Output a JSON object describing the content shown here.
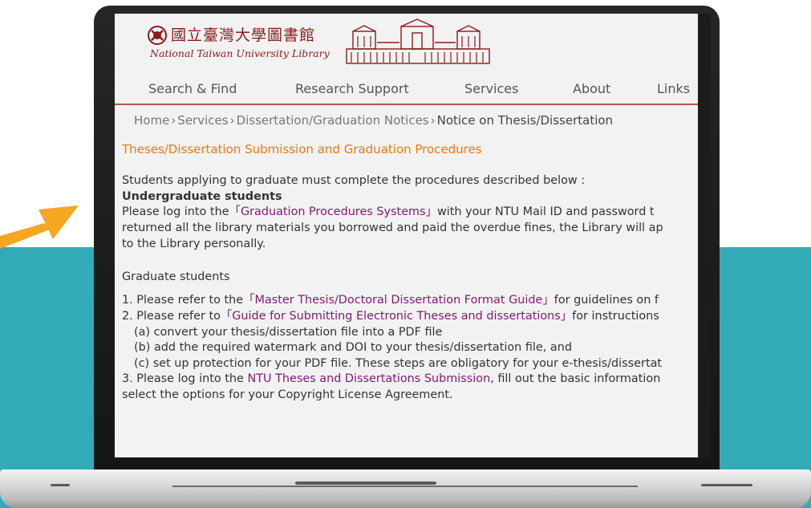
{
  "library": {
    "name_zh": "國立臺灣大學圖書館",
    "name_en": "National Taiwan University Library"
  },
  "nav": {
    "items": [
      "Search & Find",
      "Research Support",
      "Services",
      "About",
      "Links"
    ]
  },
  "breadcrumb": {
    "items": [
      "Home",
      "Services",
      "Dissertation/Graduation Notices"
    ],
    "current": "Notice on Thesis/Dissertation",
    "separator": "›"
  },
  "content": {
    "title": "Theses/Dissertation Submission and Graduation Procedures",
    "intro": "Students applying to graduate must complete the procedures described below :",
    "undergrad": {
      "heading": "Undergraduate students",
      "line1_pre": "Please log into the",
      "line1_link": "「Graduation Procedures Systems」",
      "line1_post": "with your NTU Mail ID and password t",
      "line2": "returned all the library materials you borrowed and paid the overdue fines, the Library will ap",
      "line3": "to the Library personally."
    },
    "grad": {
      "heading": "Graduate students",
      "item1_pre": "1. Please refer to the",
      "item1_link": "「Master Thesis/Doctoral Dissertation Format Guide」",
      "item1_post": "for guidelines on f",
      "item2_pre": "2. Please refer to",
      "item2_link": "「Guide for Submitting Electronic Theses and dissertations」",
      "item2_post": "for instructions",
      "item2a": "(a) convert your thesis/dissertation file into a PDF file",
      "item2b": "(b) add the required watermark and DOI to your thesis/dissertation file, and",
      "item2c": "(c) set up protection for your PDF file. These steps are obligatory for your e-thesis/dissertat",
      "item3_pre": "3. Please log into the",
      "item3_link": "NTU Theses and Dissertations Submission",
      "item3_post": ",  fill out the basic information",
      "item3_line2": "select the options for your Copyright License Agreement."
    }
  },
  "colors": {
    "teal_band": "#33aab8",
    "arrow": "#f5a623",
    "title_orange": "#ee7a0c",
    "link_purple": "#7b1c72",
    "brand_red": "#8b1a1a"
  }
}
